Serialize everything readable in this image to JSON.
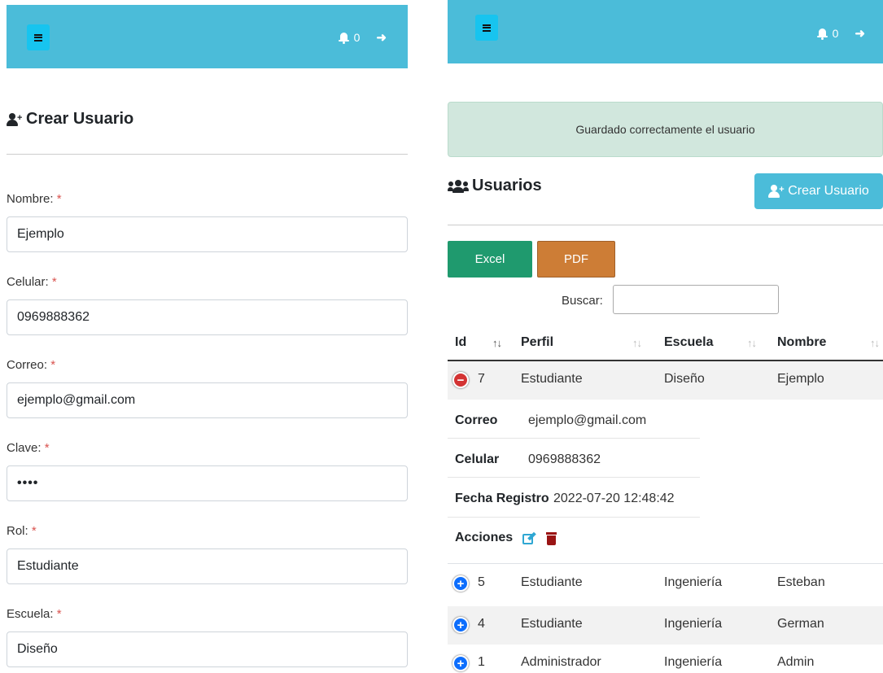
{
  "left": {
    "topbar": {
      "notifications": "0"
    },
    "title": "Crear Usuario",
    "form": {
      "nombre": {
        "label": "Nombre:",
        "value": "Ejemplo"
      },
      "celular": {
        "label": "Celular:",
        "value": "0969888362"
      },
      "correo": {
        "label": "Correo:",
        "value": "ejemplo@gmail.com"
      },
      "clave": {
        "label": "Clave:",
        "value": "••••"
      },
      "rol": {
        "label": "Rol:",
        "value": "Estudiante"
      },
      "escuela": {
        "label": "Escuela:",
        "value": "Diseño"
      },
      "required_mark": "*"
    }
  },
  "right": {
    "topbar": {
      "notifications": "0"
    },
    "alert": "Guardado correctamente el usuario",
    "title": "Usuarios",
    "create_button": "Crear Usuario",
    "export": {
      "excel": "Excel",
      "pdf": "PDF"
    },
    "search_label": "Buscar:",
    "columns": [
      "Id",
      "Perfil",
      "Escuela",
      "Nombre"
    ],
    "rows": [
      {
        "id": "7",
        "perfil": "Estudiante",
        "escuela": "Diseño",
        "nombre": "Ejemplo",
        "toggle": "−"
      },
      {
        "id": "5",
        "perfil": "Estudiante",
        "escuela": "Ingeniería",
        "nombre": "Esteban",
        "toggle": "+"
      },
      {
        "id": "4",
        "perfil": "Estudiante",
        "escuela": "Ingeniería",
        "nombre": "German",
        "toggle": "+"
      },
      {
        "id": "1",
        "perfil": "Administrador",
        "escuela": "Ingeniería",
        "nombre": "Admin",
        "toggle": "+"
      }
    ],
    "detail": {
      "correo": {
        "key": "Correo",
        "value": "ejemplo@gmail.com"
      },
      "celular": {
        "key": "Celular",
        "value": "0969888362"
      },
      "fecha": {
        "key": "Fecha Registro",
        "value": "2022-07-20 12:48:42"
      },
      "acciones": {
        "key": "Acciones"
      }
    }
  },
  "icons": {
    "menu": "menu-icon",
    "bell": "bell-icon",
    "logout": "logout-icon",
    "user_plus": "user-plus-icon",
    "users": "users-icon",
    "edit": "edit-icon",
    "trash": "trash-icon"
  },
  "colors": {
    "topbar": "#4bbcd9",
    "menu_button": "#17c4ef",
    "alert_bg": "#d1e7dd",
    "excel": "#1f9a6e",
    "pdf": "#cd7d36",
    "required": "#d9534f",
    "toggle_minus": "#d33333",
    "toggle_plus": "#0d6efd",
    "trash": "#9a1414",
    "edit": "#2fa7d3"
  }
}
